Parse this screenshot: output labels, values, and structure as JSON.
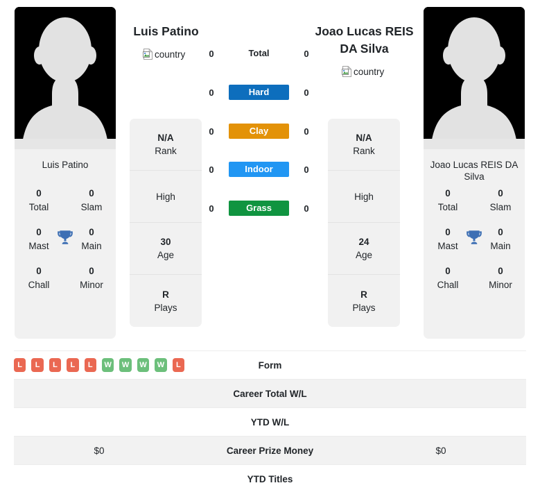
{
  "players": {
    "left": {
      "name": "Luis Patino",
      "card_name": "Luis Patino",
      "country_alt": "country",
      "photo_alt": "player-photo",
      "titles": [
        {
          "num": "0",
          "label": "Total"
        },
        {
          "num": "0",
          "label": "Slam"
        },
        {
          "num": "0",
          "label": "Mast"
        },
        {
          "num": "0",
          "label": "Main"
        },
        {
          "num": "0",
          "label": "Chall"
        },
        {
          "num": "0",
          "label": "Minor"
        }
      ],
      "info": [
        {
          "value": "N/A",
          "key": "Rank"
        },
        {
          "value": "",
          "key": "High"
        },
        {
          "value": "30",
          "key": "Age"
        },
        {
          "value": "R",
          "key": "Plays"
        }
      ]
    },
    "right": {
      "name": "Joao Lucas REIS DA Silva",
      "card_name": "Joao Lucas REIS DA Silva",
      "country_alt": "country",
      "photo_alt": "player-photo",
      "titles": [
        {
          "num": "0",
          "label": "Total"
        },
        {
          "num": "0",
          "label": "Slam"
        },
        {
          "num": "0",
          "label": "Mast"
        },
        {
          "num": "0",
          "label": "Main"
        },
        {
          "num": "0",
          "label": "Chall"
        },
        {
          "num": "0",
          "label": "Minor"
        }
      ],
      "info": [
        {
          "value": "N/A",
          "key": "Rank"
        },
        {
          "value": "",
          "key": "High"
        },
        {
          "value": "24",
          "key": "Age"
        },
        {
          "value": "R",
          "key": "Plays"
        }
      ]
    }
  },
  "surfaces": [
    {
      "label": "Total",
      "left": "0",
      "right": "0",
      "color": "",
      "plain": true
    },
    {
      "label": "Hard",
      "left": "0",
      "right": "0",
      "color": "#0d6ebd",
      "plain": false
    },
    {
      "label": "Clay",
      "left": "0",
      "right": "0",
      "color": "#e39208",
      "plain": false
    },
    {
      "label": "Indoor",
      "left": "0",
      "right": "0",
      "color": "#2196f3",
      "plain": false
    },
    {
      "label": "Grass",
      "left": "0",
      "right": "0",
      "color": "#109440",
      "plain": false
    }
  ],
  "stat_rows": [
    {
      "label": "Form",
      "left_form": [
        "L",
        "L",
        "L",
        "L",
        "L",
        "W",
        "W",
        "W",
        "W",
        "L"
      ],
      "right_form": [],
      "left_text": "",
      "right_text": "",
      "alt": false
    },
    {
      "label": "Career Total W/L",
      "left_text": "",
      "right_text": "",
      "alt": true
    },
    {
      "label": "YTD W/L",
      "left_text": "",
      "right_text": "",
      "alt": false
    },
    {
      "label": "Career Prize Money",
      "left_text": "$0",
      "right_text": "$0",
      "alt": true
    },
    {
      "label": "YTD Titles",
      "left_text": "",
      "right_text": "",
      "alt": false
    }
  ],
  "colors": {
    "win": "#6cbf7b",
    "loss": "#ea6852",
    "trophy": "#3d6fb4",
    "card_bg": "#f1f1f1",
    "row_alt": "#f2f2f2"
  }
}
